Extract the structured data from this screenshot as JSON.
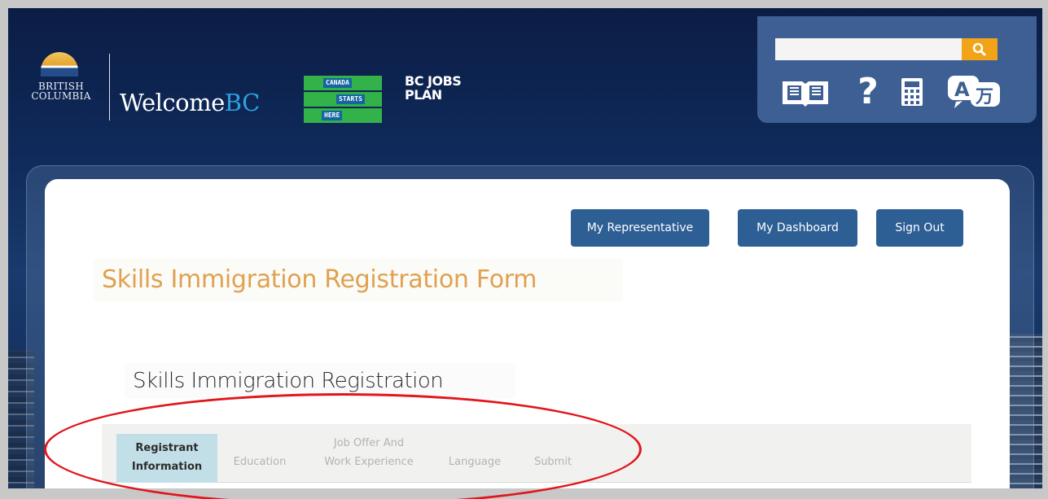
{
  "header": {
    "province_logo_line1": "BRITISH",
    "province_logo_line2": "COLUMBIA",
    "brand_prefix": "Welcome",
    "brand_suffix": "BC",
    "canada_logo_line1": "CANADA",
    "canada_logo_line2": "STARTS",
    "canada_logo_line3": "HERE",
    "jobs_logo_line1": "BC JOBS",
    "jobs_logo_line2": "PLAN"
  },
  "tools": {
    "search_placeholder": "",
    "icons": [
      "search-icon",
      "book-icon",
      "help-icon",
      "calculator-icon",
      "translate-icon"
    ],
    "accent_color": "#f2a419"
  },
  "nav_buttons": {
    "representative": "My Representative",
    "dashboard": "My Dashboard",
    "sign_out": "Sign Out"
  },
  "page": {
    "title": "Skills Immigration Registration Form",
    "section_title": "Skills Immigration Registration"
  },
  "steps": [
    {
      "line1": "Registrant",
      "line2": "Information",
      "active": true
    },
    {
      "line1": "Education",
      "line2": "",
      "active": false
    },
    {
      "line1": "Job Offer And",
      "line2": "Work Experience",
      "active": false
    },
    {
      "line1": "Language",
      "line2": "",
      "active": false
    },
    {
      "line1": "Submit",
      "line2": "",
      "active": false
    }
  ],
  "colors": {
    "header_bg": "#0f2a5a",
    "button_bg": "#2d5f95",
    "title_color": "#e0a14f",
    "active_step_bg": "#c2dfe8",
    "highlight_oval": "#e0161b"
  }
}
